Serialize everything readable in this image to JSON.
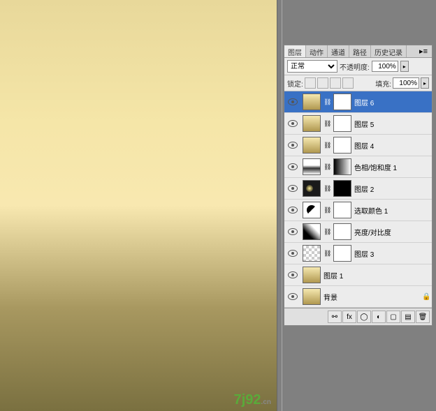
{
  "tabs": [
    "图层",
    "动作",
    "通道",
    "路径",
    "历史记录"
  ],
  "active_tab": 0,
  "blend_mode": "正常",
  "opacity_label": "不透明度:",
  "opacity_value": "100%",
  "lock_label": "锁定:",
  "fill_label": "填充:",
  "fill_value": "100%",
  "layers": [
    {
      "name": "图层 6",
      "selected": true,
      "thumb": "photo",
      "mask": "white"
    },
    {
      "name": "图层 5",
      "thumb": "photo",
      "mask": "white"
    },
    {
      "name": "图层 4",
      "thumb": "photo",
      "mask": "white"
    },
    {
      "name": "色相/饱和度 1",
      "thumb": "grad",
      "mask": "gradient",
      "adj": true
    },
    {
      "name": "图层 2",
      "thumb": "dark",
      "mask": "black"
    },
    {
      "name": "选取颜色 1",
      "thumb": "adj",
      "mask": "white",
      "adj": true
    },
    {
      "name": "亮度/对比度",
      "thumb": "bc",
      "mask": "white",
      "adj": true
    },
    {
      "name": "图层 3",
      "thumb": "trans",
      "mask": "white"
    },
    {
      "name": "图层 1",
      "thumb": "photo"
    },
    {
      "name": "背景",
      "thumb": "photo",
      "locked": true
    }
  ],
  "watermark": {
    "text": "7j92",
    "suffix": ".cn"
  }
}
